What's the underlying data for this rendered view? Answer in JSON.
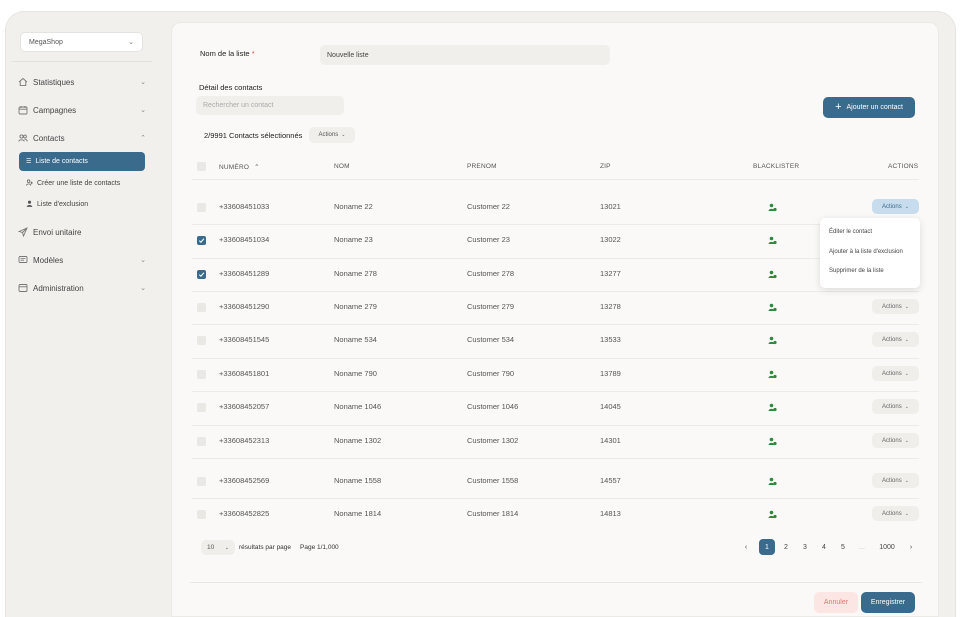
{
  "sidebar": {
    "shop_name": "MegaShop",
    "items": [
      {
        "label": "Statistiques",
        "icon": "home-icon",
        "chevron": "⌄"
      },
      {
        "label": "Campagnes",
        "icon": "calendar-icon",
        "chevron": "⌄"
      },
      {
        "label": "Contacts",
        "icon": "users-icon",
        "chevron": "⌃"
      },
      {
        "label": "Envoi unitaire",
        "icon": "send-icon",
        "chevron": ""
      },
      {
        "label": "Modèles",
        "icon": "message-icon",
        "chevron": "⌄"
      },
      {
        "label": "Administration",
        "icon": "admin-icon",
        "chevron": "⌄"
      }
    ],
    "subitems": [
      {
        "label": "Liste de contacts",
        "icon": "list-icon",
        "active": true
      },
      {
        "label": "Créer une liste de contacts",
        "icon": "user-add-icon",
        "active": false
      },
      {
        "label": "Liste d'exclusion",
        "icon": "user-icon",
        "active": false
      }
    ]
  },
  "form": {
    "list_name_label": "Nom de la liste",
    "required_mark": "*",
    "list_name_value": "Nouvelle liste",
    "contacts_section_label": "Détail des contacts",
    "search_placeholder": "Rechercher un contact",
    "add_contact_label": "Ajouter un contact",
    "selected_text": "2/9991 Contacts sélectionnés",
    "bulk_actions_label": "Actions"
  },
  "table": {
    "headers": {
      "numero": "NUMÉRO",
      "sort_icon": "⌃",
      "nom": "NOM",
      "prenom": "PRENOM",
      "zip": "ZIP",
      "blacklister": "BLACKLISTER",
      "actions": "ACTIONS"
    },
    "action_label": "Actions",
    "rows": [
      {
        "numero": "+33608451033",
        "nom": "Noname 22",
        "prenom": "Customer 22",
        "zip": "13021",
        "checked": false
      },
      {
        "numero": "+33608451034",
        "nom": "Noname 23",
        "prenom": "Customer 23",
        "zip": "13022",
        "checked": true
      },
      {
        "numero": "+33608451289",
        "nom": "Noname 278",
        "prenom": "Customer 278",
        "zip": "13277",
        "checked": true
      },
      {
        "numero": "+33608451290",
        "nom": "Noname 279",
        "prenom": "Customer 279",
        "zip": "13278",
        "checked": false
      },
      {
        "numero": "+33608451545",
        "nom": "Noname 534",
        "prenom": "Customer 534",
        "zip": "13533",
        "checked": false
      },
      {
        "numero": "+33608451801",
        "nom": "Noname 790",
        "prenom": "Customer 790",
        "zip": "13789",
        "checked": false
      },
      {
        "numero": "+33608452057",
        "nom": "Noname 1046",
        "prenom": "Customer 1046",
        "zip": "14045",
        "checked": false
      },
      {
        "numero": "+33608452313",
        "nom": "Noname 1302",
        "prenom": "Customer 1302",
        "zip": "14301",
        "checked": false
      },
      {
        "numero": "+33608452569",
        "nom": "Noname 1558",
        "prenom": "Customer 1558",
        "zip": "14557",
        "checked": false
      },
      {
        "numero": "+33608452825",
        "nom": "Noname 1814",
        "prenom": "Customer 1814",
        "zip": "14813",
        "checked": false
      }
    ],
    "dropdown": {
      "items": [
        "Éditer le contact",
        "Ajouter à la liste d'exclusion",
        "Supprimer de la liste"
      ]
    }
  },
  "pagination": {
    "page_size": "10",
    "results_label": "résultats par page",
    "page_info": "Page 1/1,000",
    "prev": "‹",
    "next": "›",
    "pages": [
      "1",
      "2",
      "3",
      "4",
      "5",
      "...",
      "1000"
    ],
    "current": "1"
  },
  "footer": {
    "cancel_label": "Annuler",
    "save_label": "Enregistrer"
  },
  "colors": {
    "primary": "#3a6b8d",
    "blacklist_icon": "#2e8b3d",
    "cancel_text": "#e07a70",
    "cancel_bg": "#fbe6e4"
  }
}
